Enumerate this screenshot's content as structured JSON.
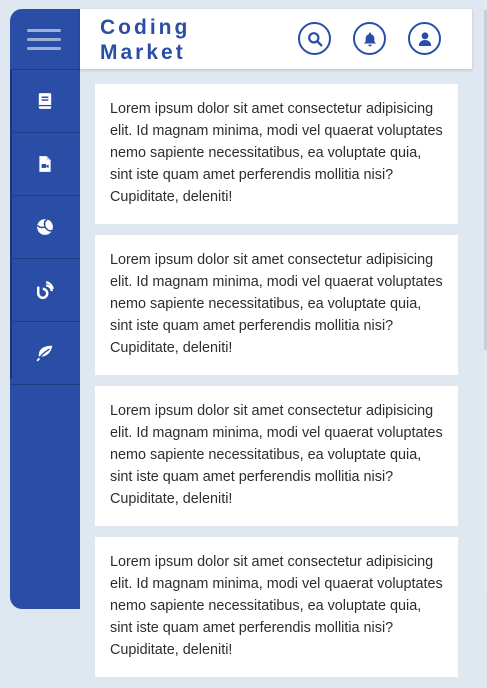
{
  "app": {
    "title_line1": "Coding",
    "title_line2": "Market"
  },
  "colors": {
    "primary": "#2a4ea6",
    "background": "#dfe8f1",
    "card": "#ffffff"
  },
  "header": {
    "buttons": [
      {
        "icon": "search-icon"
      },
      {
        "icon": "bell-icon"
      },
      {
        "icon": "user-icon"
      }
    ]
  },
  "sidebar": {
    "menu_icon": "hamburger-icon",
    "items": [
      {
        "icon": "book-icon"
      },
      {
        "icon": "file-video-icon"
      },
      {
        "icon": "volleyball-icon"
      },
      {
        "icon": "blog-icon"
      },
      {
        "icon": "leaf-icon"
      }
    ]
  },
  "cards": [
    {
      "text": "Lorem ipsum dolor sit amet consectetur adipisicing elit. Id magnam minima, modi vel quaerat voluptates nemo sapiente necessitatibus, ea voluptate quia, sint iste quam amet perferendis mollitia nisi? Cupiditate, deleniti!"
    },
    {
      "text": "Lorem ipsum dolor sit amet consectetur adipisicing elit. Id magnam minima, modi vel quaerat voluptates nemo sapiente necessitatibus, ea voluptate quia, sint iste quam amet perferendis mollitia nisi? Cupiditate, deleniti!"
    },
    {
      "text": "Lorem ipsum dolor sit amet consectetur adipisicing elit. Id magnam minima, modi vel quaerat voluptates nemo sapiente necessitatibus, ea voluptate quia, sint iste quam amet perferendis mollitia nisi? Cupiditate, deleniti!"
    },
    {
      "text": "Lorem ipsum dolor sit amet consectetur adipisicing elit. Id magnam minima, modi vel quaerat voluptates nemo sapiente necessitatibus, ea voluptate quia, sint iste quam amet perferendis mollitia nisi? Cupiditate, deleniti!"
    }
  ]
}
